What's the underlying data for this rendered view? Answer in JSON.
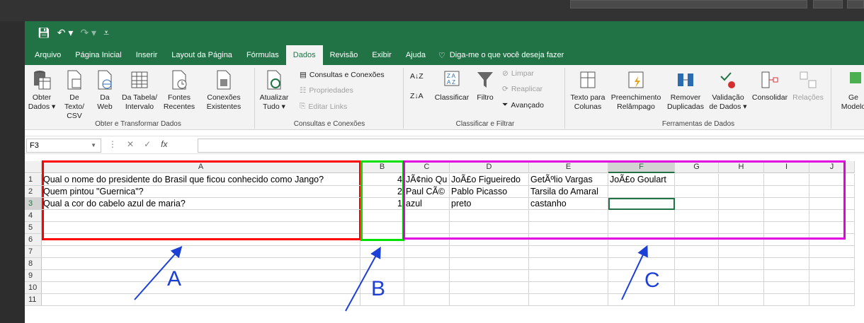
{
  "menu": {
    "items": [
      "Arquivo",
      "Página Inicial",
      "Inserir",
      "Layout da Página",
      "Fórmulas",
      "Dados",
      "Revisão",
      "Exibir",
      "Ajuda"
    ],
    "active": "Dados",
    "tell_me": "Diga-me o que você deseja fazer"
  },
  "ribbon": {
    "obter_dados": [
      "Obter",
      "Dados ▾"
    ],
    "de_texto": [
      "De Texto/",
      "CSV"
    ],
    "da_web": [
      "Da",
      "Web"
    ],
    "da_tabela": [
      "Da Tabela/",
      "Intervalo"
    ],
    "fontes_recentes": [
      "Fontes",
      "Recentes"
    ],
    "conexoes_existentes": [
      "Conexões",
      "Existentes"
    ],
    "group_obter": "Obter e Transformar Dados",
    "atualizar_tudo": [
      "Atualizar",
      "Tudo ▾"
    ],
    "consultas_conexoes": "Consultas e Conexões",
    "propriedades": "Propriedades",
    "editar_links": "Editar Links",
    "group_consultas": "Consultas e Conexões",
    "classificar": "Classificar",
    "filtro": "Filtro",
    "limpar": "Limpar",
    "reaplicar": "Reaplicar",
    "avancado": "Avançado",
    "group_classificar": "Classificar e Filtrar",
    "texto_colunas": [
      "Texto para",
      "Colunas"
    ],
    "preenchimento": [
      "Preenchimento",
      "Relâmpago"
    ],
    "remover_dup": [
      "Remover",
      "Duplicadas"
    ],
    "validacao": [
      "Validação",
      "de Dados ▾"
    ],
    "consolidar": "Consolidar",
    "relacoes": "Relações",
    "group_ferramentas": "Ferramentas de Dados",
    "ge_modelo": [
      "Ge",
      "Modelo"
    ]
  },
  "formula_bar": {
    "name_box": "F3",
    "formula": ""
  },
  "columns": [
    "A",
    "B",
    "C",
    "D",
    "E",
    "F",
    "G",
    "H",
    "I",
    "J"
  ],
  "rows": [
    "1",
    "2",
    "3",
    "4",
    "5",
    "6",
    "7",
    "8",
    "9",
    "10",
    "11"
  ],
  "cells": {
    "r1": {
      "A": "Qual o nome do presidente do Brasil que ficou conhecido como Jango?",
      "B": "4",
      "C": "JÃ¢nio Qu",
      "D": "JoÃ£o Figueiredo",
      "E": "GetÃºlio Vargas",
      "F": "JoÃ£o Goulart"
    },
    "r2": {
      "A": "Quem pintou \"Guernica\"?",
      "B": "2",
      "C": "Paul CÃ©",
      "D": "Pablo Picasso",
      "E": "Tarsila do Amaral",
      "F": ""
    },
    "r3": {
      "A": "Qual a cor do cabelo azul de maria?",
      "B": "1",
      "C": "azul",
      "D": "preto",
      "E": "castanho",
      "F": ""
    }
  },
  "annotations": {
    "a": "A",
    "b": "B",
    "c": "C"
  },
  "colors": {
    "excel_green": "#217346",
    "box_a": "#ff0000",
    "box_b": "#00e000",
    "box_c": "#e000e0",
    "arrow": "#1c3fd6"
  }
}
